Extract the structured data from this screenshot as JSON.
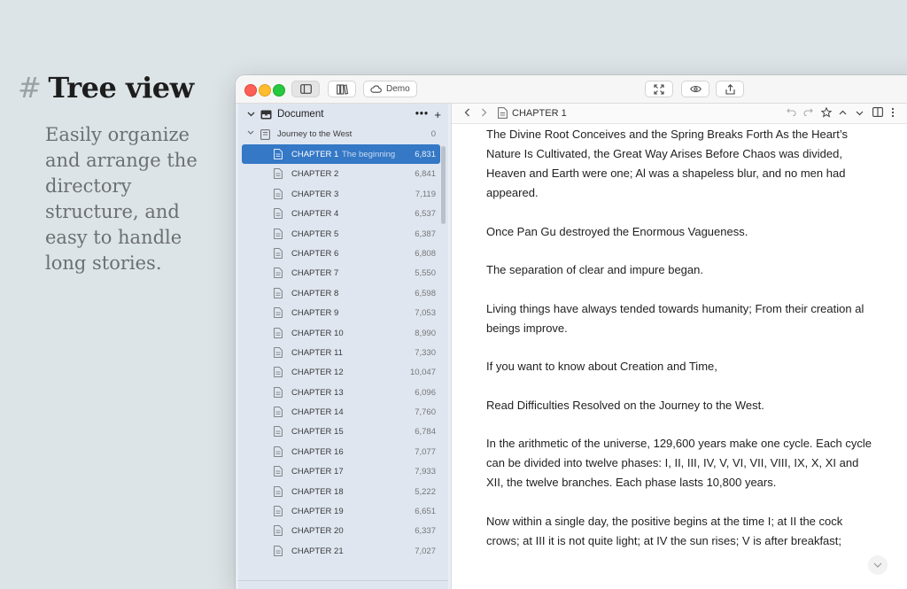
{
  "promo": {
    "hash": "#",
    "title": "Tree view",
    "body": "Easily organize and arrange the directory structure, and easy to handle long stories."
  },
  "toolbar": {
    "demo_label": "Demo",
    "icons": [
      "sidebar-icon",
      "library-icon",
      "cloud-icon",
      "fullscreen-icon",
      "preview-eye-icon",
      "share-icon"
    ]
  },
  "sidebar": {
    "section_label": "Document",
    "more_label": "•••",
    "add_label": "+",
    "book": {
      "title": "Journey to the West",
      "count": "0"
    },
    "chapters": [
      {
        "title": "CHAPTER 1",
        "subtitle": "The beginning",
        "words": "6,831",
        "selected": true
      },
      {
        "title": "CHAPTER 2",
        "subtitle": "",
        "words": "6,841"
      },
      {
        "title": "CHAPTER 3",
        "subtitle": "",
        "words": "7,119"
      },
      {
        "title": "CHAPTER 4",
        "subtitle": "",
        "words": "6,537"
      },
      {
        "title": "CHAPTER 5",
        "subtitle": "",
        "words": "6,387"
      },
      {
        "title": "CHAPTER 6",
        "subtitle": "",
        "words": "6,808"
      },
      {
        "title": "CHAPTER 7",
        "subtitle": "",
        "words": "5,550"
      },
      {
        "title": "CHAPTER 8",
        "subtitle": "",
        "words": "6,598"
      },
      {
        "title": "CHAPTER 9",
        "subtitle": "",
        "words": "7,053"
      },
      {
        "title": "CHAPTER 10",
        "subtitle": "",
        "words": "8,990"
      },
      {
        "title": "CHAPTER 11",
        "subtitle": "",
        "words": "7,330"
      },
      {
        "title": "CHAPTER 12",
        "subtitle": "",
        "words": "10,047"
      },
      {
        "title": "CHAPTER 13",
        "subtitle": "",
        "words": "6,096"
      },
      {
        "title": "CHAPTER 14",
        "subtitle": "",
        "words": "7,760"
      },
      {
        "title": "CHAPTER 15",
        "subtitle": "",
        "words": "6,784"
      },
      {
        "title": "CHAPTER 16",
        "subtitle": "",
        "words": "7,077"
      },
      {
        "title": "CHAPTER 17",
        "subtitle": "",
        "words": "7,933"
      },
      {
        "title": "CHAPTER 18",
        "subtitle": "",
        "words": "5,222"
      },
      {
        "title": "CHAPTER 19",
        "subtitle": "",
        "words": "6,651"
      },
      {
        "title": "CHAPTER 20",
        "subtitle": "",
        "words": "6,337"
      },
      {
        "title": "CHAPTER 21",
        "subtitle": "",
        "words": "7,027"
      }
    ]
  },
  "editor": {
    "title": "CHAPTER 1",
    "paragraphs": [
      "The Divine Root Conceives and the Spring Breaks Forth As the Heart’s Nature Is Cultivated, the Great Way Arises Before Chaos was divided, Heaven and Earth were one; Al was a shapeless blur, and no men had appeared.",
      "Once Pan Gu destroyed the Enormous Vagueness.",
      "The separation of clear and impure began.",
      "Living things have always tended towards humanity; From their creation al beings improve.",
      "If you want to know about Creation and Time,",
      "Read Difficulties Resolved on the Journey to the West.",
      "In the arithmetic of the universe, 129,600 years make one cycle. Each cycle can be divided into twelve phases: I, II, III, IV, V, VI, VII, VIII, IX, X, XI and XII, the twelve branches. Each phase lasts 10,800 years.",
      "Now within a single day, the positive begins at the time I; at II the cock crows; at III it is not quite light; at IV the sun rises; V is after breakfast;"
    ]
  },
  "colors": {
    "accent": "#3478c6",
    "sidebar_bg": "#dfe6f0",
    "page_bg": "#dde4e7"
  }
}
